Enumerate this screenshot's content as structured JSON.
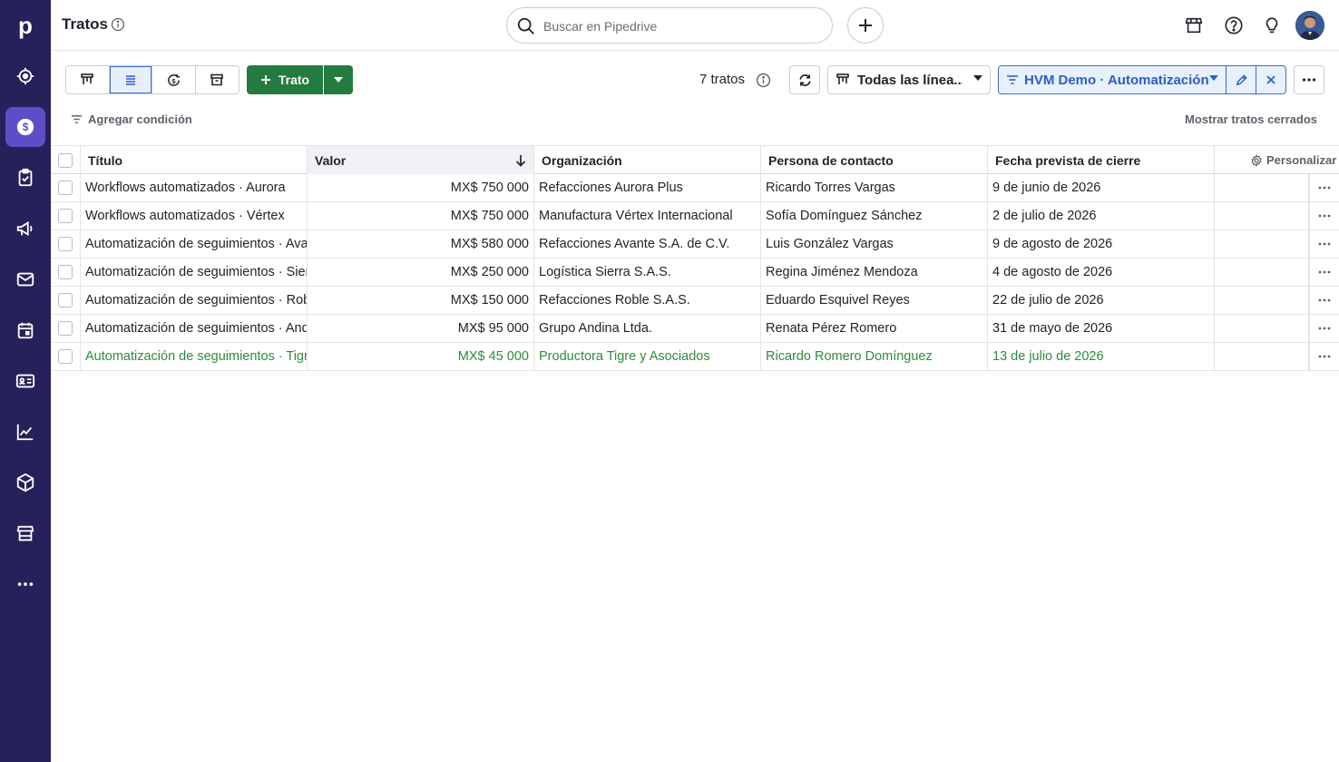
{
  "app": {
    "logo": "p",
    "brand_color": "#25215a",
    "active_nav_color": "#5b4ec6"
  },
  "sidebar": {
    "items": [
      {
        "name": "leads",
        "icon": "target-icon"
      },
      {
        "name": "deals",
        "icon": "dollar-icon",
        "active": true
      },
      {
        "name": "activities",
        "icon": "clipboard-check-icon"
      },
      {
        "name": "campaigns",
        "icon": "megaphone-icon"
      },
      {
        "name": "mail",
        "icon": "mail-icon"
      },
      {
        "name": "calendar",
        "icon": "calendar-icon"
      },
      {
        "name": "contacts",
        "icon": "contact-card-icon"
      },
      {
        "name": "insights",
        "icon": "chart-icon"
      },
      {
        "name": "products",
        "icon": "box-icon"
      },
      {
        "name": "marketplace",
        "icon": "store-icon"
      },
      {
        "name": "more",
        "icon": "more-horizontal-icon"
      }
    ]
  },
  "header": {
    "title": "Tratos",
    "search_placeholder": "Buscar en Pipedrive"
  },
  "toolbar": {
    "add_deal_label": "Trato",
    "deal_count": "7 tratos",
    "pipeline_label": "Todas las línea...",
    "filter_label": "HVM Demo · Automatización",
    "add_condition": "Agregar condición",
    "show_closed": "Mostrar tratos cerrados"
  },
  "table": {
    "columns": [
      "Título",
      "Valor",
      "Organización",
      "Persona de contacto",
      "Fecha prevista de cierre"
    ],
    "personalize": "Personalizar",
    "sorted_column": "Valor",
    "sort_direction": "descending",
    "rows": [
      {
        "title": "Workflows automatizados · Aurora",
        "value": "MX$ 750 000",
        "org": "Refacciones Aurora Plus",
        "person": "Ricardo Torres Vargas",
        "date": "9 de junio de 2026",
        "won": false
      },
      {
        "title": "Workflows automatizados · Vértex",
        "value": "MX$ 750 000",
        "org": "Manufactura Vértex Internacional",
        "person": "Sofía Domínguez Sánchez",
        "date": "2 de julio de 2026",
        "won": false
      },
      {
        "title": "Automatización de seguimientos · Avante",
        "value": "MX$ 580 000",
        "org": "Refacciones Avante S.A. de C.V.",
        "person": "Luis González Vargas",
        "date": "9 de agosto de 2026",
        "won": false
      },
      {
        "title": "Automatización de seguimientos · Sierra",
        "value": "MX$ 250 000",
        "org": "Logística Sierra S.A.S.",
        "person": "Regina Jiménez Mendoza",
        "date": "4 de agosto de 2026",
        "won": false
      },
      {
        "title": "Automatización de seguimientos · Roble",
        "value": "MX$ 150 000",
        "org": "Refacciones Roble S.A.S.",
        "person": "Eduardo Esquivel Reyes",
        "date": "22 de julio de 2026",
        "won": false
      },
      {
        "title": "Automatización de seguimientos · Andina",
        "value": "MX$ 95 000",
        "org": "Grupo Andina Ltda.",
        "person": "Renata Pérez Romero",
        "date": "31 de mayo de 2026",
        "won": false
      },
      {
        "title": "Automatización de seguimientos · Tigre",
        "value": "MX$ 45 000",
        "org": "Productora Tigre y Asociados",
        "person": "Ricardo Romero Domínguez",
        "date": "13 de julio de 2026",
        "won": true
      }
    ]
  },
  "colors": {
    "green_button": "#237b3f",
    "filter_blue": "#2c5fc2",
    "won_text": "#2f8a3a"
  }
}
